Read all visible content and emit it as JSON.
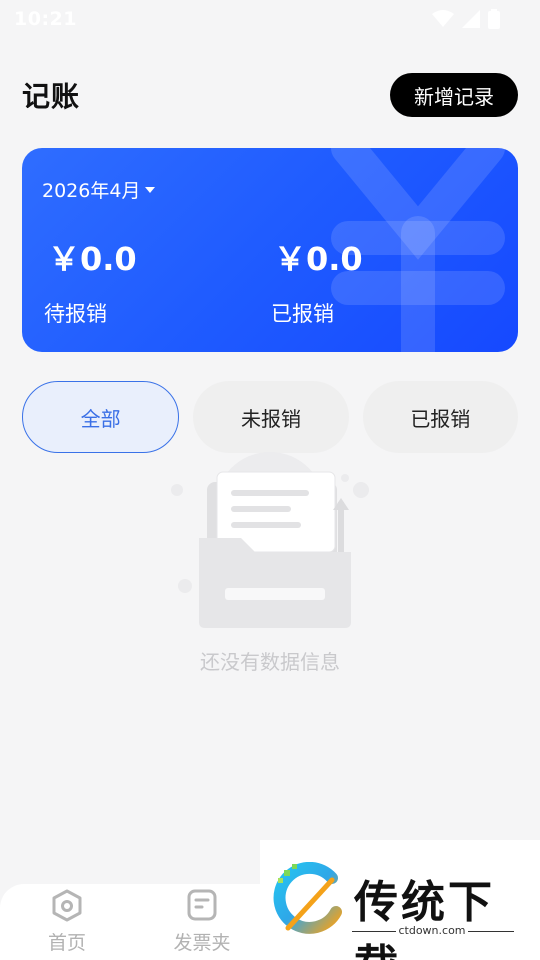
{
  "status_bar": {
    "time": "10:21"
  },
  "header": {
    "title": "记账",
    "add_label": "新增记录"
  },
  "summary": {
    "period": "2026年4月",
    "pending": {
      "amount": "￥0.0",
      "label": "待报销"
    },
    "reimbursed": {
      "amount": "￥0.0",
      "label": "已报销"
    }
  },
  "tabs": [
    {
      "label": "全部",
      "active": true
    },
    {
      "label": "未报销",
      "active": false
    },
    {
      "label": "已报销",
      "active": false
    }
  ],
  "empty_state": {
    "message": "还没有数据信息"
  },
  "bottom_nav": [
    {
      "label": "首页",
      "icon": "camera-home-icon"
    },
    {
      "label": "发票夹",
      "icon": "invoice-folder-icon"
    }
  ],
  "watermark": {
    "text": "传统下载",
    "url": "ctdown.com"
  },
  "colors": {
    "primary": "#1f5bff",
    "active_tab": "#3a6fe6",
    "button": "#000000"
  }
}
